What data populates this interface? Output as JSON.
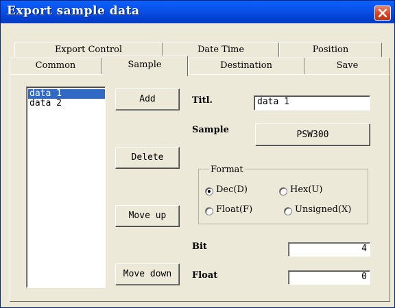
{
  "window": {
    "title": "Export sample data"
  },
  "tabs": {
    "row1": [
      "Export Control",
      "Date Time",
      "Position"
    ],
    "row2": [
      "Common",
      "Sample",
      "Destination",
      "Save"
    ],
    "active": "Sample"
  },
  "list": {
    "items": [
      "data 1",
      "data 2"
    ],
    "selected": "data 1"
  },
  "buttons": {
    "add": "Add",
    "delete": "Delete",
    "move_up": "Move up",
    "move_down": "Move down",
    "sample_value": "PSW300"
  },
  "fields": {
    "title_label": "Titl.",
    "title_value": "data 1",
    "sample_label": "Sample",
    "bit_label": "Bit",
    "bit_value": "4",
    "float_label": "Float",
    "float_value": "0"
  },
  "format": {
    "legend": "Format",
    "options": [
      "Dec(D)",
      "Hex(U)",
      "Float(F)",
      "Unsigned(X)"
    ],
    "selected": "Dec(D)"
  }
}
